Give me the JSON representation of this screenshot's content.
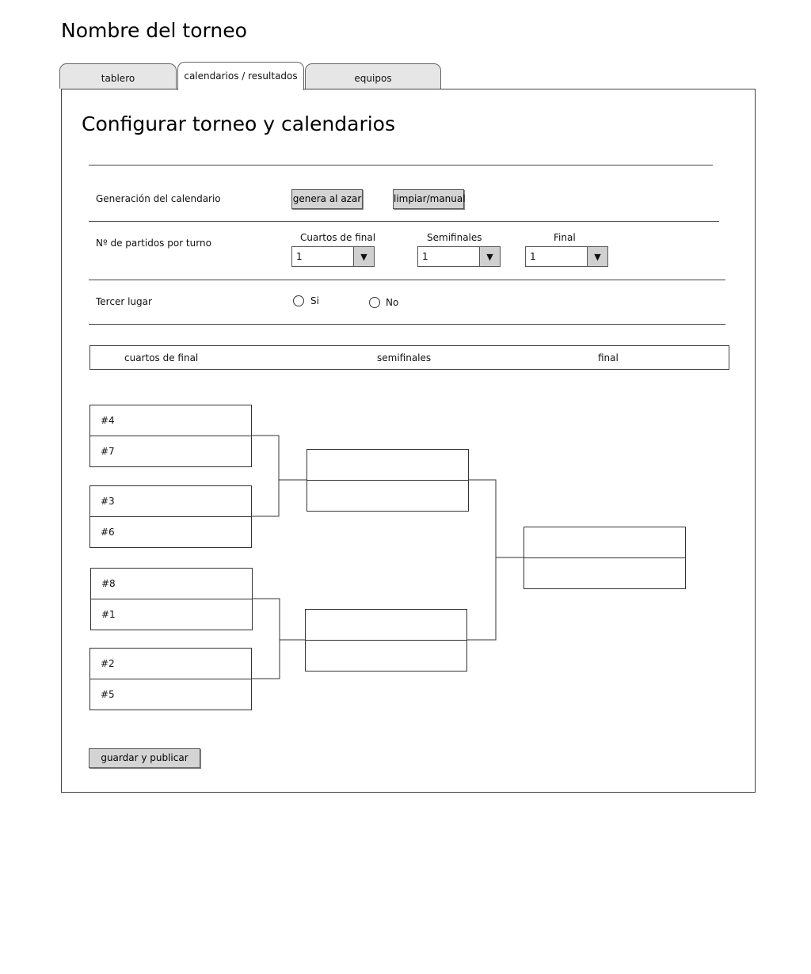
{
  "app": {
    "title": "Nombre del torneo"
  },
  "tabs": [
    {
      "label": "tablero",
      "active": false
    },
    {
      "label": "calendarios / resultados",
      "active": true
    },
    {
      "label": "equipos",
      "active": false
    }
  ],
  "config": {
    "heading": "Configurar torneo y calendarios",
    "generation": {
      "label": "Generación del calendario",
      "random_button": "genera al azar",
      "manual_button": "limpiar/manual"
    },
    "matches_per_turn": {
      "label": "Nº de partidos por turno",
      "quarterfinals": {
        "label": "Cuartos de final",
        "value": "1"
      },
      "semifinals": {
        "label": "Semifinales",
        "value": "1"
      },
      "final": {
        "label": "Final",
        "value": "1"
      }
    },
    "third_place": {
      "label": "Tercer lugar",
      "yes": "Si",
      "no": "No"
    }
  },
  "bracket": {
    "headers": {
      "quarterfinals": "cuartos de final",
      "semifinals": "semifinales",
      "final": "final"
    },
    "quarterfinal_matches": [
      {
        "top": "#4",
        "bottom": "#7"
      },
      {
        "top": "#3",
        "bottom": "#6"
      },
      {
        "top": "#8",
        "bottom": "#1"
      },
      {
        "top": "#2",
        "bottom": "#5"
      }
    ],
    "semifinal_matches": [
      {
        "top": "",
        "bottom": ""
      },
      {
        "top": "",
        "bottom": ""
      }
    ],
    "final_match": {
      "top": "",
      "bottom": ""
    }
  },
  "actions": {
    "save_publish": "guardar y publicar"
  }
}
